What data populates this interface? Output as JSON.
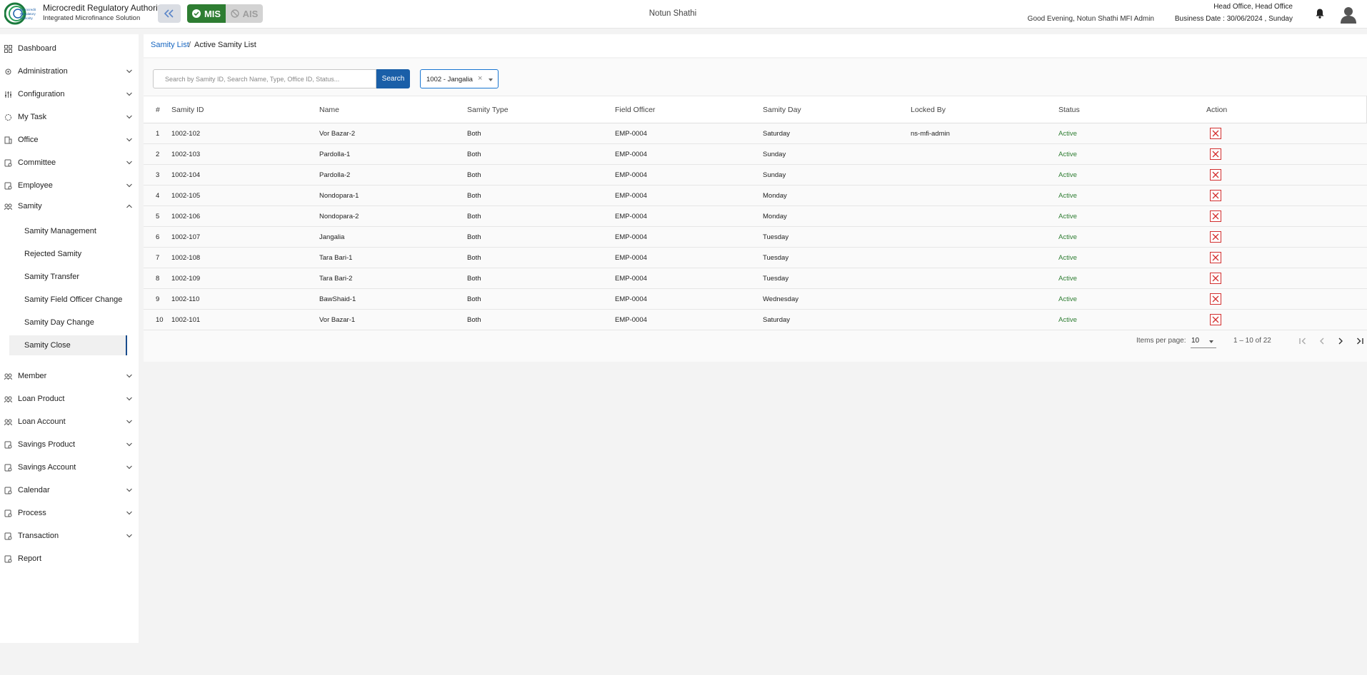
{
  "header": {
    "brand_title": "Microcredit Regulatory Authority",
    "brand_subtitle": "Integrated Microfinance Solution",
    "logo_text": "Microcredit Regulatory Authority",
    "mis_label": "MIS",
    "ais_label": "AIS",
    "center_title": "Notun Shathi",
    "greeting": "Good Evening, Notun Shathi MFI Admin",
    "office": "Head Office, Head Office",
    "business_date": "Business Date : 30/06/2024 , Sunday",
    "colors": {
      "mis": "#2e7d32",
      "ais": "#d3d3d3",
      "primary": "#1a5fa8"
    }
  },
  "sidebar": {
    "items": [
      {
        "label": "Dashboard",
        "icon": "dashboard-icon"
      },
      {
        "label": "Administration",
        "icon": "admin-icon"
      },
      {
        "label": "Configuration",
        "icon": "config-icon"
      },
      {
        "label": "My Task",
        "icon": "task-icon"
      },
      {
        "label": "Office",
        "icon": "office-icon"
      },
      {
        "label": "Committee",
        "icon": "committee-icon"
      },
      {
        "label": "Employee",
        "icon": "employee-icon"
      },
      {
        "label": "Samity",
        "icon": "samity-icon"
      }
    ],
    "samity_subitems": [
      {
        "label": "Samity Management"
      },
      {
        "label": "Rejected Samity"
      },
      {
        "label": "Samity Transfer"
      },
      {
        "label": "Samity Field Officer Change"
      },
      {
        "label": "Samity Day Change"
      },
      {
        "label": "Samity Close"
      }
    ],
    "items_after": [
      {
        "label": "Member",
        "icon": "member-icon"
      },
      {
        "label": "Loan Product",
        "icon": "loan-product-icon"
      },
      {
        "label": "Loan Account",
        "icon": "loan-account-icon"
      },
      {
        "label": "Savings Product",
        "icon": "savings-product-icon"
      },
      {
        "label": "Savings Account",
        "icon": "savings-account-icon"
      },
      {
        "label": "Calendar",
        "icon": "calendar-icon"
      },
      {
        "label": "Process",
        "icon": "process-icon"
      },
      {
        "label": "Transaction",
        "icon": "transaction-icon"
      },
      {
        "label": "Report",
        "icon": "report-icon"
      }
    ]
  },
  "breadcrumb": {
    "link": "Samity List",
    "separator": "/",
    "current": "Active Samity List"
  },
  "search": {
    "placeholder": "Search by Samity ID, Search Name, Type, Office ID, Status...",
    "value": "",
    "button_label": "Search"
  },
  "filter": {
    "selected": "1002 - Jangalia",
    "clear": "×"
  },
  "table": {
    "headers": [
      "#",
      "Samity ID",
      "Name",
      "Samity Type",
      "Field Officer",
      "Samity Day",
      "Locked By",
      "Status",
      "Action"
    ],
    "rows": [
      {
        "num": "1",
        "id": "1002-102",
        "name": "Vor Bazar-2",
        "type": "Both",
        "officer": "EMP-0004",
        "day": "Saturday",
        "locked": "ns-mfi-admin",
        "status": "Active"
      },
      {
        "num": "2",
        "id": "1002-103",
        "name": "Pardolla-1",
        "type": "Both",
        "officer": "EMP-0004",
        "day": "Sunday",
        "locked": "",
        "status": "Active"
      },
      {
        "num": "3",
        "id": "1002-104",
        "name": "Pardolla-2",
        "type": "Both",
        "officer": "EMP-0004",
        "day": "Sunday",
        "locked": "",
        "status": "Active"
      },
      {
        "num": "4",
        "id": "1002-105",
        "name": "Nondopara-1",
        "type": "Both",
        "officer": "EMP-0004",
        "day": "Monday",
        "locked": "",
        "status": "Active"
      },
      {
        "num": "5",
        "id": "1002-106",
        "name": "Nondopara-2",
        "type": "Both",
        "officer": "EMP-0004",
        "day": "Monday",
        "locked": "",
        "status": "Active"
      },
      {
        "num": "6",
        "id": "1002-107",
        "name": "Jangalia",
        "type": "Both",
        "officer": "EMP-0004",
        "day": "Tuesday",
        "locked": "",
        "status": "Active"
      },
      {
        "num": "7",
        "id": "1002-108",
        "name": "Tara Bari-1",
        "type": "Both",
        "officer": "EMP-0004",
        "day": "Tuesday",
        "locked": "",
        "status": "Active"
      },
      {
        "num": "8",
        "id": "1002-109",
        "name": "Tara Bari-2",
        "type": "Both",
        "officer": "EMP-0004",
        "day": "Tuesday",
        "locked": "",
        "status": "Active"
      },
      {
        "num": "9",
        "id": "1002-110",
        "name": "BawShaid-1",
        "type": "Both",
        "officer": "EMP-0004",
        "day": "Wednesday",
        "locked": "",
        "status": "Active"
      },
      {
        "num": "10",
        "id": "1002-101",
        "name": "Vor Bazar-1",
        "type": "Both",
        "officer": "EMP-0004",
        "day": "Saturday",
        "locked": "",
        "status": "Active"
      }
    ]
  },
  "paginator": {
    "items_per_page_label": "Items per page:",
    "page_size": "10",
    "range": "1 – 10 of 22"
  }
}
